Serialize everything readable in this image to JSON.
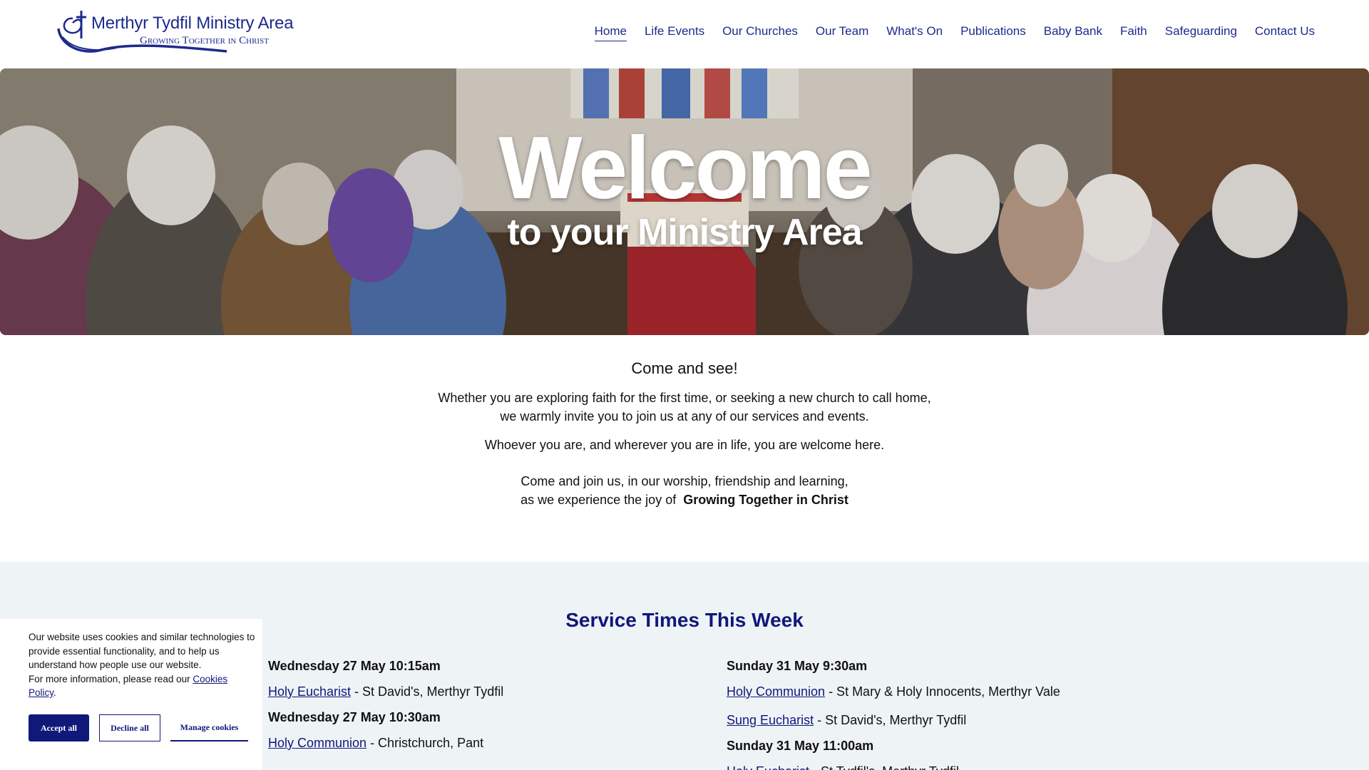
{
  "site": {
    "logo_title": "Merthyr Tydfil Ministry Area",
    "logo_tagline": "Growing Together in Christ",
    "brand_color": "#1d2a8c"
  },
  "nav": {
    "items": [
      "Home",
      "Life Events",
      "Our Churches",
      "Our Team",
      "What's On",
      "Publications",
      "Baby Bank",
      "Faith",
      "Safeguarding",
      "Contact Us"
    ],
    "active": "Home"
  },
  "hero": {
    "title": "Welcome",
    "subtitle": "to your Ministry Area"
  },
  "intro": {
    "heading": "Come and see!",
    "para1_line1": "Whether you are exploring faith for the first time, or seeking a new church to call home,",
    "para1_line2": "we warmly invite you to join us at any of our services and events.",
    "para2": "Whoever you are, and wherever you are in life, you are welcome here.",
    "para3_line1": "Come and join us, in our worship, friendship and learning,",
    "para3_line2_prefix": "as we experience the joy of",
    "para3_line2_bold": "Growing Together in Christ"
  },
  "services": {
    "heading": "Service Times This Week",
    "left": [
      {
        "day": "Wednesday 27 May 10:15am",
        "service": "Holy Eucharist",
        "location": " - St David's, Merthyr Tydfil"
      },
      {
        "day": "Wednesday 27 May 10:30am",
        "service": "Holy Communion",
        "location": " - Christchurch, Pant"
      }
    ],
    "right_day1": "Sunday 31 May 9:30am",
    "right_day1_items": [
      {
        "service": "Holy Communion",
        "location": " - St Mary & Holy Innocents, Merthyr Vale"
      },
      {
        "service": "Sung Eucharist",
        "location": " - St David's, Merthyr Tydfil"
      }
    ],
    "right_day2": "Sunday 31 May 11:00am",
    "right_day2_items": [
      {
        "service": "Holy Eucharist",
        "location": " - St Tydfil's, Merthyr Tydfil"
      }
    ]
  },
  "cookie": {
    "line1": "Our website uses cookies and similar technologies to provide essential functionality, and to help us understand how people use our website.",
    "line2_prefix": "For more information, please read our",
    "link": "Cookies Policy",
    "line2_suffix": ".",
    "accept": "Accept all",
    "decline": "Decline all",
    "manage": "Manage cookies"
  }
}
